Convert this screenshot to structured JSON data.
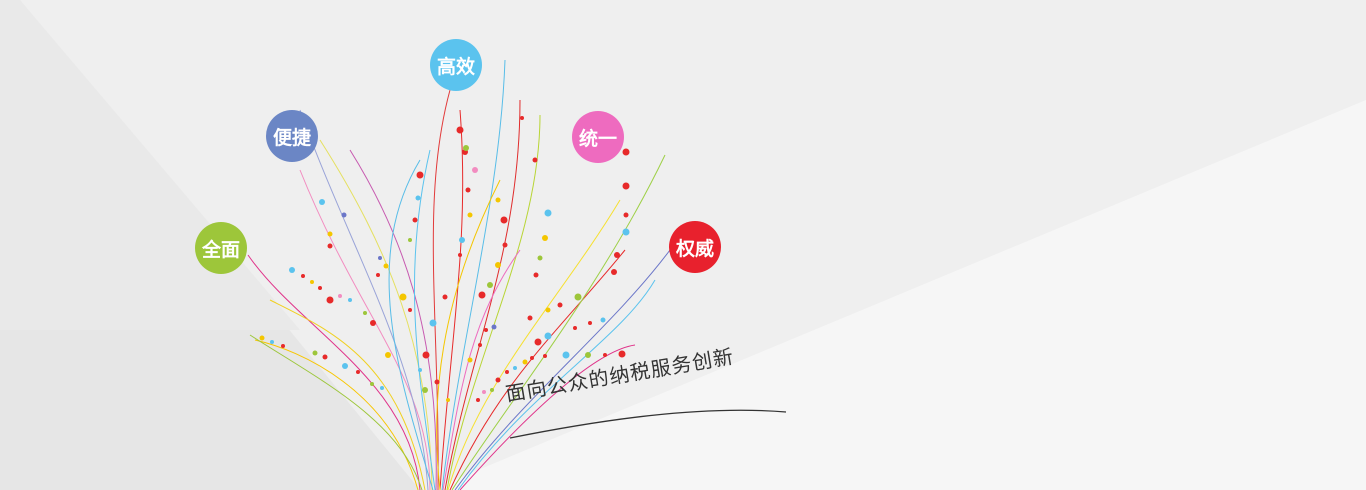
{
  "banner": {
    "bubbles": [
      {
        "label": "高效",
        "color": "#5bc3ee"
      },
      {
        "label": "便捷",
        "color": "#6b86c5"
      },
      {
        "label": "统一",
        "color": "#ee6bbf"
      },
      {
        "label": "全面",
        "color": "#9dc63a"
      },
      {
        "label": "权威",
        "color": "#e8212d"
      }
    ],
    "slogan": "面向公众的纳税服务创新"
  }
}
